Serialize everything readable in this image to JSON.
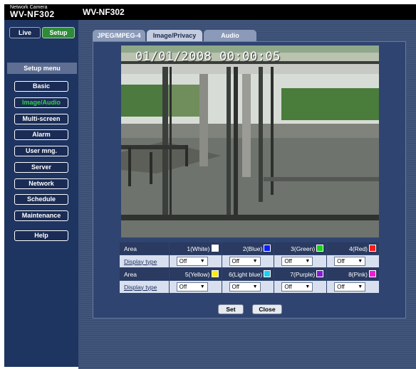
{
  "brand": {
    "small": "Network Camera",
    "model": "WV-NF302"
  },
  "header": {
    "title": "WV-NF302"
  },
  "mode": {
    "live": "Live",
    "setup": "Setup"
  },
  "setup_menu": {
    "title": "Setup menu",
    "items": [
      "Basic",
      "Image/Audio",
      "Multi-screen",
      "Alarm",
      "User mng.",
      "Server",
      "Network",
      "Schedule",
      "Maintenance"
    ],
    "active": "Image/Audio",
    "help": "Help"
  },
  "tabs": [
    "JPEG/MPEG-4",
    "Image/Privacy",
    "Audio"
  ],
  "camera": {
    "osd": "01/01/2008 00:00:05"
  },
  "area_table": {
    "area_label": "Area",
    "display_type_label": "Display type",
    "row1": [
      {
        "name": "1(White)",
        "color": "#ffffff",
        "value": "Off"
      },
      {
        "name": "2(Blue)",
        "color": "#0a1cff",
        "value": "Off"
      },
      {
        "name": "3(Green)",
        "color": "#19d119",
        "value": "Off"
      },
      {
        "name": "4(Red)",
        "color": "#ff1a1a",
        "value": "Off"
      }
    ],
    "row2": [
      {
        "name": "5(Yellow)",
        "color": "#ffee00",
        "value": "Off"
      },
      {
        "name": "6(Light blue)",
        "color": "#19d1f2",
        "value": "Off"
      },
      {
        "name": "7(Purple)",
        "color": "#8a1ad9",
        "value": "Off"
      },
      {
        "name": "8(Pink)",
        "color": "#f21ad1",
        "value": "Off"
      }
    ]
  },
  "buttons": {
    "set": "Set",
    "close": "Close"
  }
}
